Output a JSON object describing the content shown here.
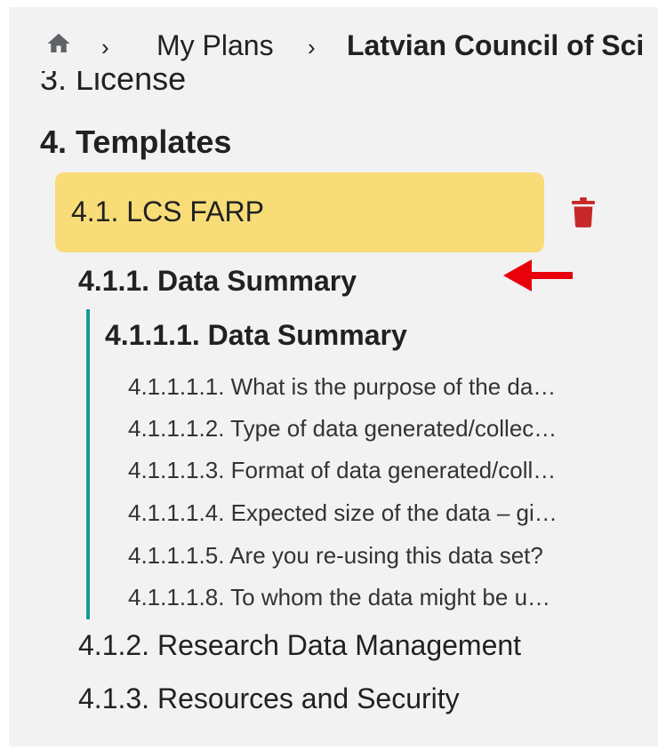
{
  "breadcrumb": {
    "home_icon": "home-icon",
    "separator": "›",
    "link": "My Plans",
    "current": "Latvian Council of Sci"
  },
  "outline": {
    "license": "3. License",
    "templates_heading": "4. Templates",
    "template": {
      "label": "4.1. LCS FARP",
      "delete_icon": "trash-icon",
      "highlight_color": "#f7dc78"
    },
    "sections": [
      {
        "label": "4.1.1. Data Summary",
        "subsection": {
          "label": "4.1.1.1. Data Summary",
          "questions": [
            "4.1.1.1.1. What is the purpose of the da…",
            "4.1.1.1.2. Type of data generated/collec…",
            "4.1.1.1.3. Format of data generated/coll…",
            "4.1.1.1.4. Expected size of the data – gi…",
            "4.1.1.1.5. Are you re-using this data set?",
            "4.1.1.1.8. To whom the data might be u…"
          ]
        }
      },
      {
        "label": "4.1.2. Research Data Management"
      },
      {
        "label": "4.1.3. Resources and Security"
      }
    ]
  },
  "colors": {
    "accent_line": "#1a9a93",
    "delete_red": "#c62828",
    "annotation_arrow": "#e8000b"
  }
}
